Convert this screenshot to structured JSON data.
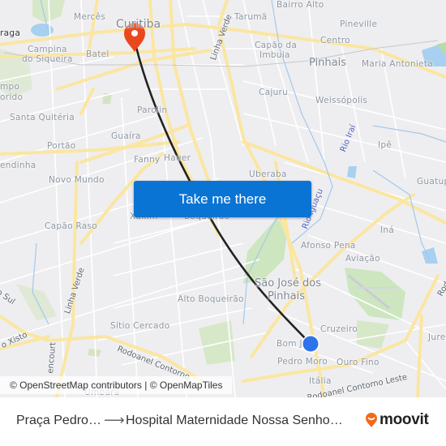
{
  "map": {
    "places": [
      {
        "id": "merces",
        "label": "Mercês"
      },
      {
        "id": "curitiba",
        "label": "Curitiba"
      },
      {
        "id": "taruma",
        "label": "Tarumã"
      },
      {
        "id": "bairro-alto",
        "label": "Bairro Alto"
      },
      {
        "id": "pineville",
        "label": "Pineville"
      },
      {
        "id": "braga",
        "label": "raga"
      },
      {
        "id": "campina",
        "label": "Campina"
      },
      {
        "id": "do-siqueira",
        "label": "do Siqueira"
      },
      {
        "id": "batel",
        "label": "Batel"
      },
      {
        "id": "capao-da",
        "label": "Capão da"
      },
      {
        "id": "imbuia",
        "label": "Imbuia"
      },
      {
        "id": "centro",
        "label": "Centro"
      },
      {
        "id": "pinhais",
        "label": "Pinhais"
      },
      {
        "id": "maria-antonieta",
        "label": "Maria Antonieta"
      },
      {
        "id": "campo",
        "label": "mpo"
      },
      {
        "id": "florido",
        "label": "orido"
      },
      {
        "id": "cajuru",
        "label": "Cajuru"
      },
      {
        "id": "parolin",
        "label": "Parolin"
      },
      {
        "id": "weissopolis",
        "label": "Weissópolis"
      },
      {
        "id": "santa-quiteria",
        "label": "Santa Quitéria"
      },
      {
        "id": "guaira",
        "label": "Guaíra"
      },
      {
        "id": "portao",
        "label": "Portão"
      },
      {
        "id": "ipe",
        "label": "Ipê"
      },
      {
        "id": "fanny",
        "label": "Fanny"
      },
      {
        "id": "hauer",
        "label": "Hauer"
      },
      {
        "id": "endinha",
        "label": "endinha"
      },
      {
        "id": "novo-mundo",
        "label": "Novo Mundo"
      },
      {
        "id": "uberaba",
        "label": "Uberaba"
      },
      {
        "id": "guatup",
        "label": "Guatup"
      },
      {
        "id": "xaxim",
        "label": "Xaxim"
      },
      {
        "id": "boqueirao",
        "label": "Boqueirão"
      },
      {
        "id": "capao-raso",
        "label": "Capão Raso"
      },
      {
        "id": "ina",
        "label": "Iná"
      },
      {
        "id": "afonso-pena",
        "label": "Afonso Pena"
      },
      {
        "id": "aviacao",
        "label": "Aviação"
      },
      {
        "id": "sao-jose-dos",
        "label": "São José dos"
      },
      {
        "id": "sjp-pinhais",
        "label": "Pinhais"
      },
      {
        "id": "alto-boqueirao",
        "label": "Alto Boqueirão"
      },
      {
        "id": "cruzeiro",
        "label": "Cruzeiro"
      },
      {
        "id": "sitio-cercado",
        "label": "Sítio Cercado"
      },
      {
        "id": "bom-jesus",
        "label": "Bom J"
      },
      {
        "id": "jurere",
        "label": "Jurer"
      },
      {
        "id": "pedro-moro",
        "label": "Pedro Moro"
      },
      {
        "id": "ouro-fino",
        "label": "Ouro Fino"
      },
      {
        "id": "italia",
        "label": "Itália"
      },
      {
        "id": "umbara",
        "label": "Umbara"
      }
    ],
    "roads": [
      {
        "id": "linha-verde-n",
        "label": "Linha Verde"
      },
      {
        "id": "linha-verde-s",
        "label": "Linha Verde"
      },
      {
        "id": "contorno-sul",
        "label": "o Sul"
      },
      {
        "id": "xisto",
        "label": "o Xisto"
      },
      {
        "id": "bettencourt",
        "label": "encourt"
      },
      {
        "id": "rodoanel",
        "label": "Rodoanel Contorno"
      },
      {
        "id": "rodoanel-leste",
        "label": "Rodoanel Contorno Leste"
      },
      {
        "id": "rod",
        "label": "Rod"
      }
    ],
    "rivers": [
      {
        "id": "rio-irai",
        "label": "Rio Iraí"
      },
      {
        "id": "rio-iguacu",
        "label": "Rio Iguaçu"
      }
    ],
    "origin_marker": {
      "icon": "origin-dot-icon",
      "color": "#2d74ea"
    },
    "destination_marker": {
      "icon": "destination-pin-icon",
      "color": "#e8481c"
    },
    "route_color": "#222222"
  },
  "cta": {
    "label": "Take me there",
    "color": "#0a74d4"
  },
  "attribution": {
    "text": "© OpenStreetMap contributors | © OpenMapTiles"
  },
  "footer": {
    "origin": "Praça Pedro…",
    "arrow_icon": "arrow-right-icon",
    "destination": "Hospital Maternidade Nossa Senho…",
    "brand": "moovit",
    "brand_color": "#f26a1b"
  }
}
